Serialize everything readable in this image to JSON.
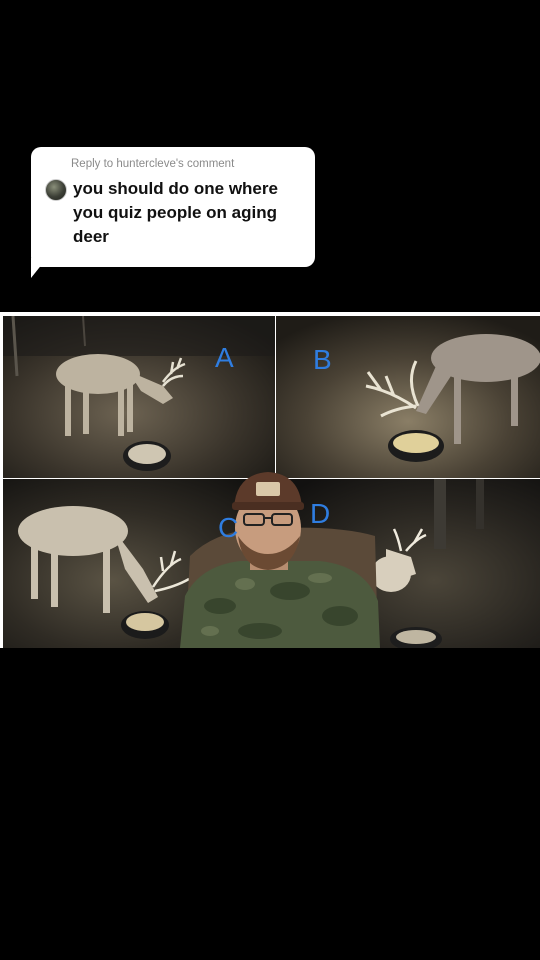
{
  "reply_card": {
    "header": "Reply to huntercleve's comment",
    "comment": "you should do one where you quiz people on aging deer",
    "avatar_icon": "user-avatar"
  },
  "quiz_panels": [
    {
      "letter": "A"
    },
    {
      "letter": "B"
    },
    {
      "letter": "C"
    },
    {
      "letter": "D"
    }
  ],
  "colors": {
    "background": "#000000",
    "label_blue": "#2f7de0",
    "bubble": "#ffffff"
  }
}
